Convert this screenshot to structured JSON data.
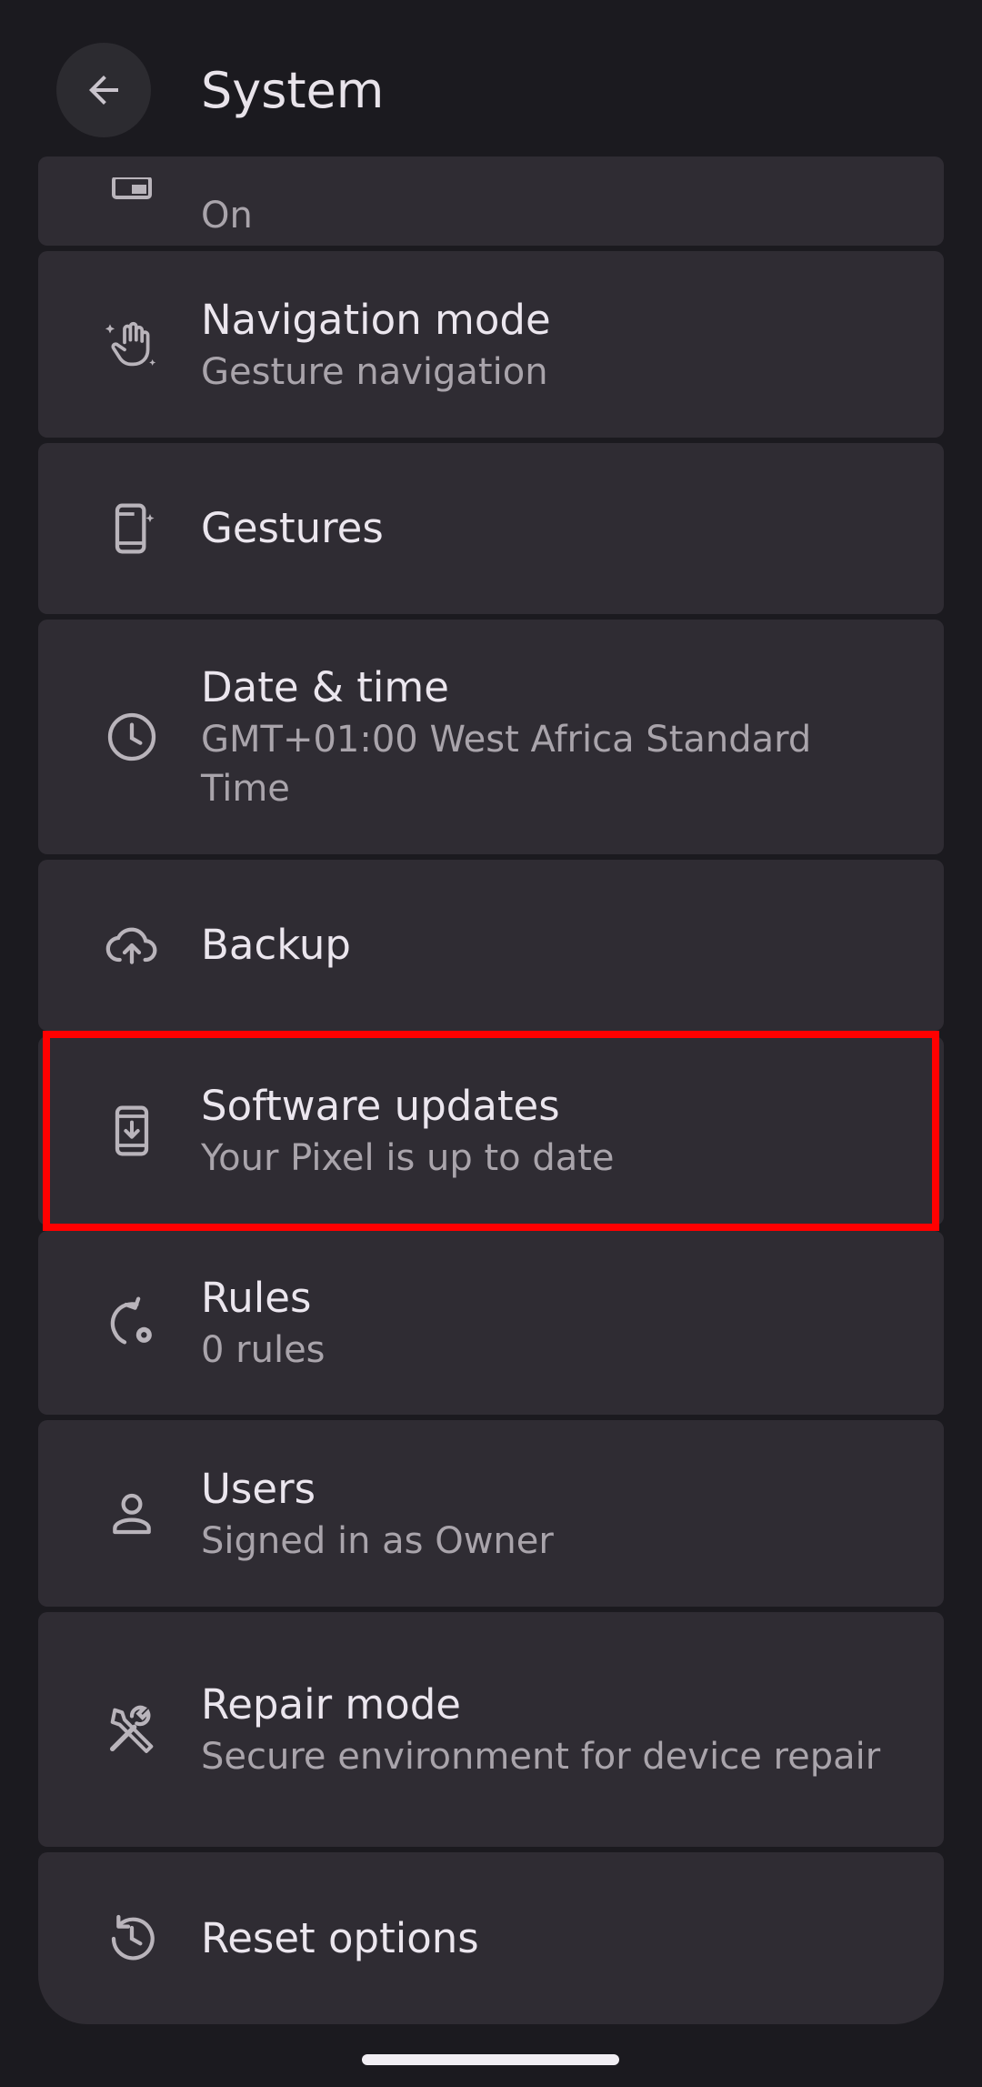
{
  "header": {
    "title": "System"
  },
  "items": [
    {
      "title": "",
      "subtitle": "On",
      "icon": "screen-cast-icon"
    },
    {
      "title": "Navigation mode",
      "subtitle": "Gesture navigation",
      "icon": "gesture-hand-icon"
    },
    {
      "title": "Gestures",
      "subtitle": "",
      "icon": "phone-sparkle-icon"
    },
    {
      "title": "Date & time",
      "subtitle": "GMT+01:00 West Africa Standard Time",
      "icon": "clock-icon"
    },
    {
      "title": "Backup",
      "subtitle": "",
      "icon": "cloud-upload-icon"
    },
    {
      "title": "Software updates",
      "subtitle": "Your Pixel is up to date",
      "icon": "phone-download-icon"
    },
    {
      "title": "Rules",
      "subtitle": "0 rules",
      "icon": "rules-cycle-icon"
    },
    {
      "title": "Users",
      "subtitle": "Signed in as Owner",
      "icon": "person-icon"
    },
    {
      "title": "Repair mode",
      "subtitle": "Secure environment for device repair",
      "icon": "repair-tools-icon"
    },
    {
      "title": "Reset options",
      "subtitle": "",
      "icon": "history-icon"
    }
  ],
  "colors": {
    "background": "#1b1a1f",
    "card": "#2f2c33",
    "highlight": "#ff0000"
  }
}
